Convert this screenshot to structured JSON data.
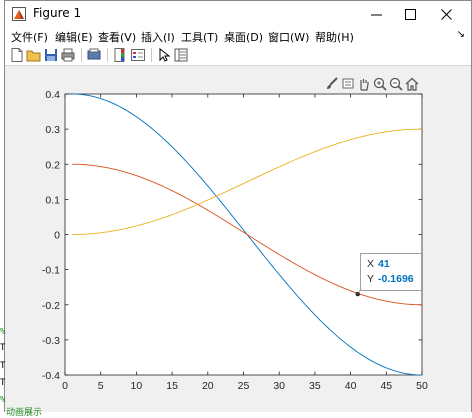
{
  "window": {
    "title": "Figure 1",
    "controls": {
      "minimize": "─",
      "maximize": "☐",
      "close": "✕"
    }
  },
  "menu": {
    "items": [
      "文件(F)",
      "编辑(E)",
      "查看(V)",
      "插入(I)",
      "工具(T)",
      "桌面(D)",
      "窗口(W)",
      "帮助(H)"
    ],
    "overflow_arrow": "↘"
  },
  "toolbar": {
    "buttons": [
      "new-figure-icon",
      "open-file-icon",
      "save-icon",
      "print-icon",
      "print-preview-icon",
      "colorbar-icon",
      "legend-icon",
      "select-arrow-icon",
      "property-inspector-icon"
    ]
  },
  "axes_toolbar": {
    "tools": [
      "brush-icon",
      "data-tip-icon",
      "pan-hand-icon",
      "zoom-in-icon",
      "zoom-out-icon",
      "home-icon"
    ]
  },
  "background_text": {
    "marks": [
      "%",
      "T",
      "T",
      "T",
      "%",
      "动画展示"
    ]
  },
  "chart_data": {
    "type": "line",
    "title": "",
    "xlabel": "",
    "ylabel": "",
    "xlim": [
      0,
      50
    ],
    "ylim": [
      -0.4,
      0.4
    ],
    "x_ticks": [
      "0",
      "5",
      "10",
      "15",
      "20",
      "25",
      "30",
      "35",
      "40",
      "45",
      "50"
    ],
    "y_ticks": [
      "0.4",
      "0.3",
      "0.2",
      "0.1",
      "0",
      "-0.1",
      "-0.2",
      "-0.3",
      "-0.4"
    ],
    "grid": false,
    "legend": "none",
    "series": [
      {
        "color": "#0072bd",
        "x": [
          1,
          5,
          10,
          15,
          20,
          25,
          30,
          35,
          40,
          45,
          50
        ],
        "y": [
          0.4,
          0.39,
          0.33,
          0.23,
          0.1,
          -0.04,
          -0.18,
          -0.3,
          -0.37,
          -0.4,
          -0.4
        ],
        "x_range": [
          1,
          50
        ],
        "amplitude": 0.4
      },
      {
        "color": "#d95319",
        "x": [
          1,
          5,
          10,
          15,
          20,
          25,
          30,
          35,
          40,
          45,
          50
        ],
        "y": [
          0.2,
          0.195,
          0.17,
          0.12,
          0.05,
          -0.02,
          -0.09,
          -0.14,
          -0.17,
          -0.19,
          -0.2
        ],
        "x_range": [
          1,
          50
        ],
        "amplitude": 0.2
      },
      {
        "color": "#edb120",
        "x": [
          1,
          5,
          10,
          15,
          20,
          25,
          30,
          35,
          40,
          45,
          50
        ],
        "y": [
          0,
          0.005,
          0.03,
          0.075,
          0.13,
          0.18,
          0.23,
          0.265,
          0.285,
          0.298,
          0.3
        ],
        "x_range": [
          1,
          50
        ],
        "amplitude": 0.3
      }
    ],
    "datatip": {
      "x_label": "X",
      "x_value": "41",
      "y_label": "Y",
      "y_value": "-0.1696",
      "point": [
        41,
        -0.1696
      ],
      "series": 1
    }
  }
}
